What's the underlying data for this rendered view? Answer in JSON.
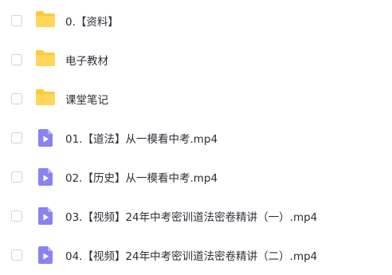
{
  "icons": {
    "folder": "folder-icon",
    "video": "video-file-icon"
  },
  "colors": {
    "folder": "#FFC93B",
    "video": "#8A82F0",
    "text": "#2b2f36",
    "checkbox_border": "#cfd3da"
  },
  "files": [
    {
      "name": "0.【资料】",
      "type": "folder"
    },
    {
      "name": "电子教材",
      "type": "folder"
    },
    {
      "name": "课堂笔记",
      "type": "folder"
    },
    {
      "name": "01.【道法】从一模看中考.mp4",
      "type": "video"
    },
    {
      "name": "02.【历史】从一模看中考.mp4",
      "type": "video"
    },
    {
      "name": "03.【视频】24年中考密训道法密卷精讲（一）.mp4",
      "type": "video"
    },
    {
      "name": "04.【视频】24年中考密训道法密卷精讲（二）.mp4",
      "type": "video"
    }
  ]
}
